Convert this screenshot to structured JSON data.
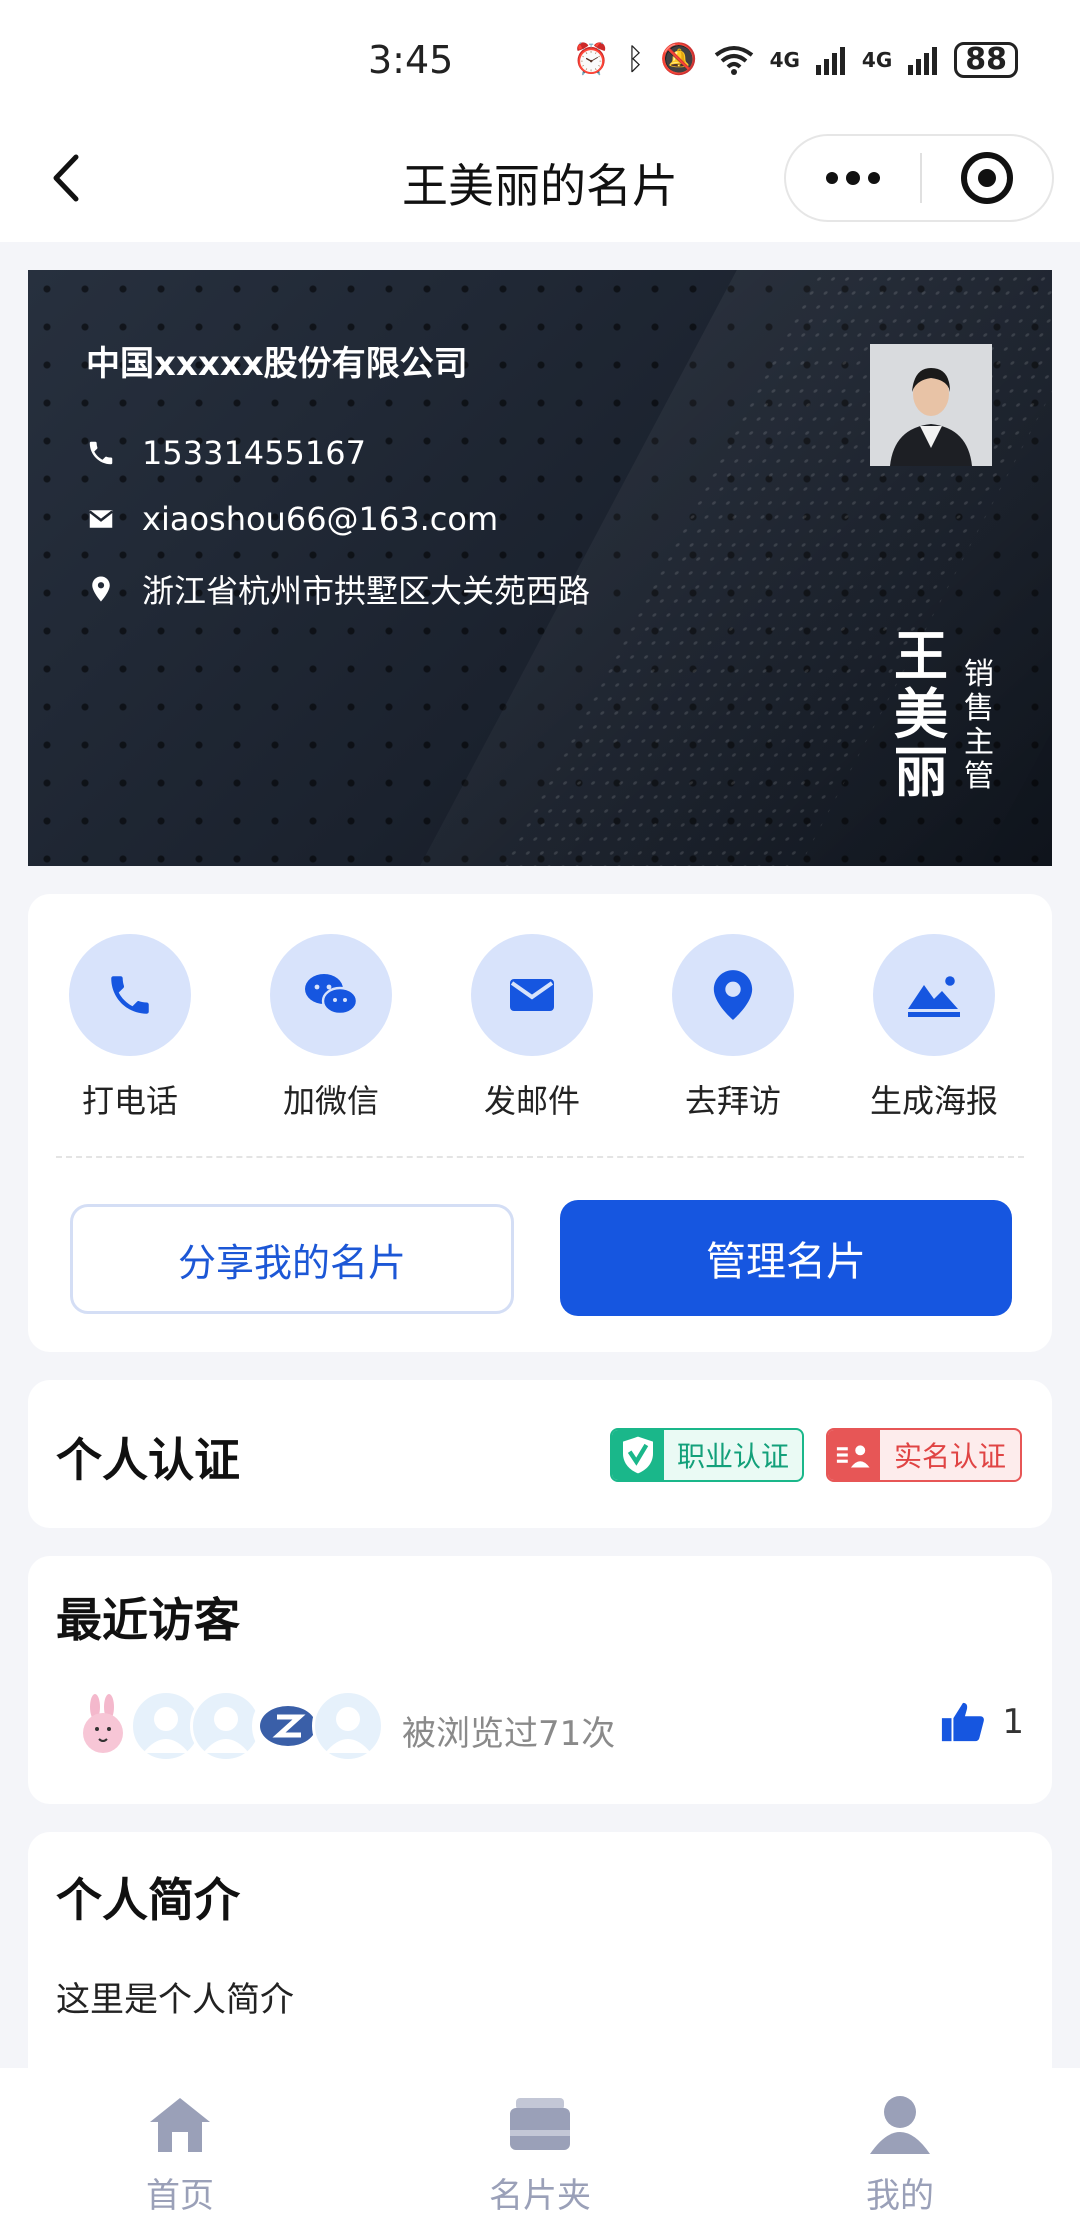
{
  "status_bar": {
    "time": "3:45",
    "signal_4g_1": "4G",
    "signal_4g_2": "4G",
    "battery": "88"
  },
  "nav": {
    "title": "王美丽的名片"
  },
  "card": {
    "company": "中国xxxxx股份有限公司",
    "phone": "15331455167",
    "email": "xiaoshou66@163.com",
    "address": "浙江省杭州市拱墅区大关苑西路",
    "name_chars": [
      "王",
      "美",
      "丽"
    ],
    "title_chars": [
      "销",
      "售",
      "主",
      "管"
    ]
  },
  "actions": [
    {
      "label": "打电话",
      "icon": "phone-icon"
    },
    {
      "label": "加微信",
      "icon": "wechat-icon"
    },
    {
      "label": "发邮件",
      "icon": "mail-icon"
    },
    {
      "label": "去拜访",
      "icon": "location-icon"
    },
    {
      "label": "生成海报",
      "icon": "poster-icon"
    }
  ],
  "buttons": {
    "share": "分享我的名片",
    "manage": "管理名片"
  },
  "certification": {
    "title": "个人认证",
    "badge_professional": "职业认证",
    "badge_realname": "实名认证"
  },
  "visitors": {
    "title": "最近访客",
    "views": "被浏览过71次",
    "likes": "1"
  },
  "intro": {
    "title": "个人简介",
    "text": "这里是个人简介"
  },
  "tabbar": [
    {
      "label": "首页",
      "icon": "home-icon"
    },
    {
      "label": "名片夹",
      "icon": "card-holder-icon"
    },
    {
      "label": "我的",
      "icon": "user-icon"
    }
  ],
  "colors": {
    "primary": "#1656e0",
    "action_circle": "#d8e3fb",
    "tab_inactive": "#9aa0b8",
    "cert_green": "#1ab78a",
    "cert_red": "#e75656"
  }
}
